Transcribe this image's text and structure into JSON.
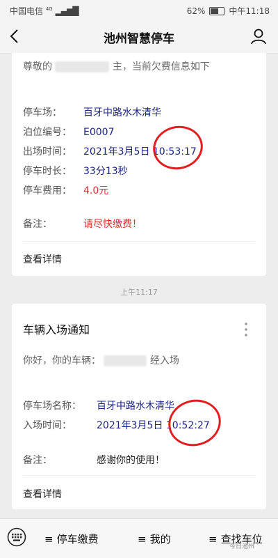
{
  "status_bar": {
    "carrier": "中国电信",
    "network": "4G",
    "battery": "62%",
    "battery_level": 0.62,
    "time": "中午11:18"
  },
  "nav": {
    "title": "池州智慧停车",
    "back_icon": "chevron-left-icon",
    "profile_icon": "person-icon"
  },
  "card1": {
    "greeting_start": "尊敬的",
    "greeting_end": "主，当前欠费信息如下",
    "fields": [
      {
        "label": "停车场：",
        "value": "百牙中路水木清华"
      },
      {
        "label": "泊位编号：",
        "value": "E0007"
      },
      {
        "label": "出场时间：",
        "value": "2021年3月5日 10:53:17"
      },
      {
        "label": "停车时长：",
        "value": "33分13秒"
      },
      {
        "label": "停车费用：",
        "value": "4.0元"
      }
    ],
    "remark_label": "备注：",
    "remark_value": "请尽快缴费！",
    "detail_link": "查看详情"
  },
  "timestamp": "上午11:17",
  "card2": {
    "title": "车辆入场通知",
    "greeting_start": "你好，你的车辆：",
    "greeting_end": "经入场",
    "fields": [
      {
        "label": "停车场名称：",
        "value": "百牙中路水木清华"
      },
      {
        "label": "入场时间：",
        "value": "2021年3月5日 10:52:27"
      }
    ],
    "remark_label": "备注：",
    "remark_value": "感谢你的使用！",
    "detail_link": "查看详情"
  },
  "bottom_menu": {
    "keyboard_icon": "keyboard-icon",
    "items": [
      "停车缴费",
      "我的",
      "查找车位"
    ]
  },
  "watermark": "今日池州",
  "colors": {
    "link_blue": "#1a237e",
    "alert_red": "#d32f2f",
    "annotation_red": "#e01f1f"
  }
}
